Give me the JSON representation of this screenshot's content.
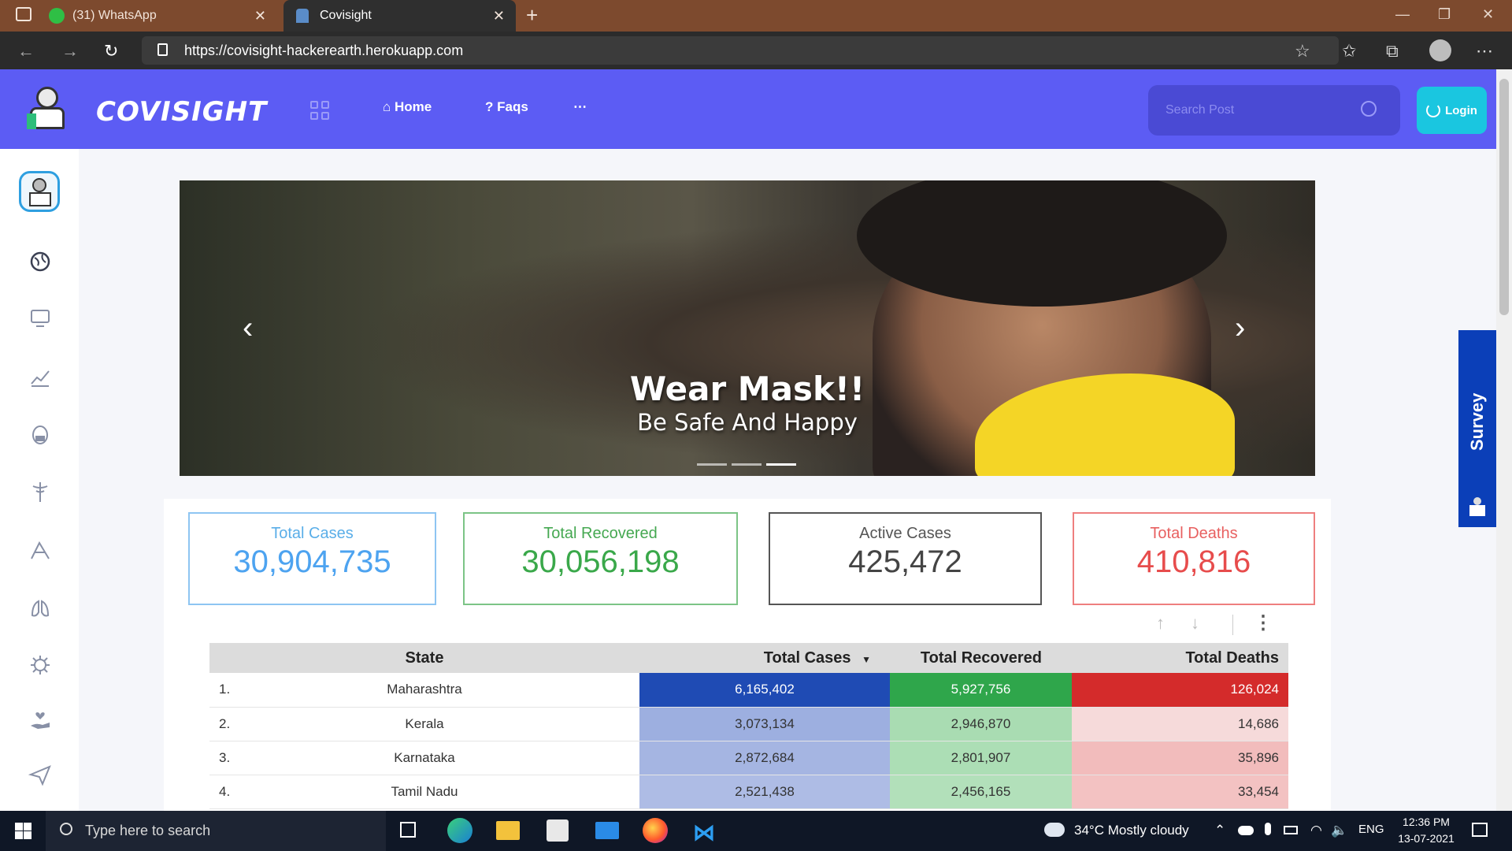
{
  "browser": {
    "tabs": [
      {
        "label": "(31) WhatsApp"
      },
      {
        "label": "Covisight"
      }
    ],
    "url": "https://covisight-hackerearth.herokuapp.com"
  },
  "header": {
    "brand": "COVISIGHT",
    "nav": [
      {
        "label": "Home",
        "icon": "home-icon"
      },
      {
        "label": "Faqs",
        "icon": "question-icon"
      },
      {
        "label": "⋯"
      }
    ],
    "search_placeholder": "Search Post",
    "login_label": "Login"
  },
  "carousel": {
    "title": "Wear Mask!!",
    "subtitle": "Be Safe And Happy",
    "active_slide": 3,
    "slide_count": 3
  },
  "stats": [
    {
      "label": "Total Cases",
      "value": "30,904,735",
      "color": "#4da3f0"
    },
    {
      "label": "Total Recovered",
      "value": "30,056,198",
      "color": "#3aa84a"
    },
    {
      "label": "Active Cases",
      "value": "425,472",
      "color": "#444444"
    },
    {
      "label": "Total Deaths",
      "value": "410,816",
      "color": "#e74c4c"
    }
  ],
  "table": {
    "headers": [
      "State",
      "Total Cases",
      "Total Recovered",
      "Total Deaths"
    ],
    "rows": [
      {
        "idx": "1.",
        "state": "Maharashtra",
        "cases": "6,165,402",
        "recovered": "5,927,756",
        "deaths": "126,024"
      },
      {
        "idx": "2.",
        "state": "Kerala",
        "cases": "3,073,134",
        "recovered": "2,946,870",
        "deaths": "14,686"
      },
      {
        "idx": "3.",
        "state": "Karnataka",
        "cases": "2,872,684",
        "recovered": "2,801,907",
        "deaths": "35,896"
      },
      {
        "idx": "4.",
        "state": "Tamil Nadu",
        "cases": "2,521,438",
        "recovered": "2,456,165",
        "deaths": "33,454"
      }
    ]
  },
  "survey_label": "Survey",
  "taskbar": {
    "search_placeholder": "Type here to search",
    "weather": "34°C  Mostly cloudy",
    "lang": "ENG",
    "time": "12:36 PM",
    "date": "13-07-2021"
  }
}
